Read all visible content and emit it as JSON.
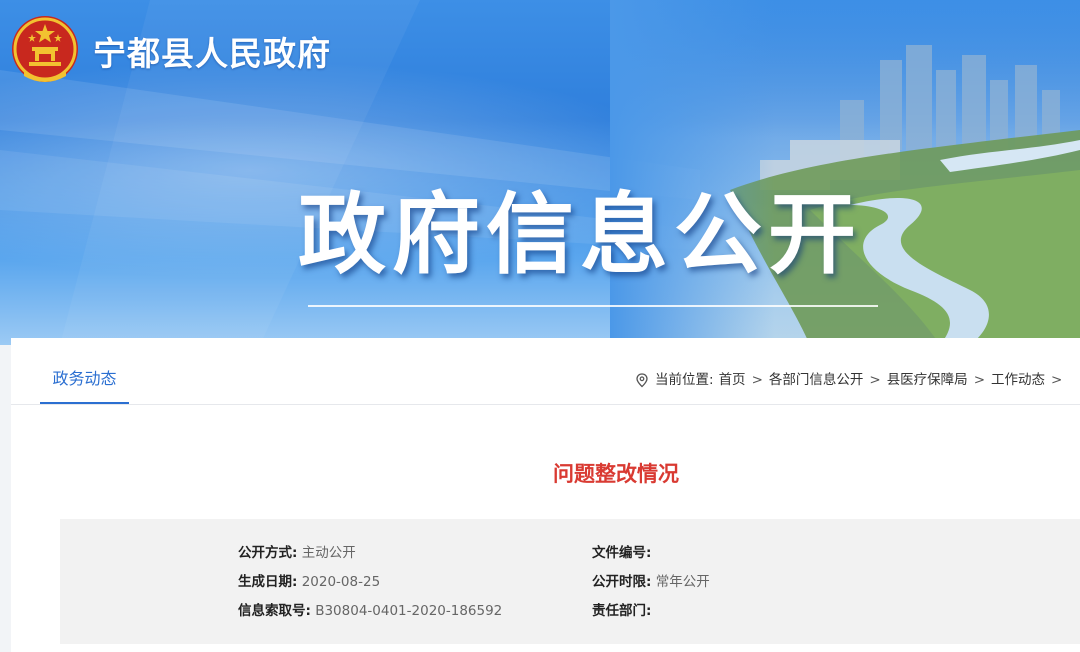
{
  "header": {
    "site_name": "宁都县人民政府",
    "hero_title": "政府信息公开"
  },
  "tabs": {
    "active_label": "政务动态"
  },
  "breadcrumb": {
    "prefix": "当前位置:",
    "items": [
      "首页",
      "各部门信息公开",
      "县医疗保障局",
      "工作动态"
    ],
    "trailing_sep": ">"
  },
  "article": {
    "title": "问题整改情况"
  },
  "meta": {
    "open_method_label": "公开方式:",
    "open_method_value": "主动公开",
    "date_label": "生成日期:",
    "date_value": "2020-08-25",
    "index_label": "信息索取号:",
    "index_value": "B30804-0401-2020-186592",
    "doc_no_label": "文件编号:",
    "doc_no_value": "",
    "period_label": "公开时限:",
    "period_value": "常年公开",
    "dept_label": "责任部门:",
    "dept_value": ""
  },
  "colors": {
    "brand_blue": "#2b6fd1",
    "title_red": "#d93a32",
    "meta_bg": "#f2f2f2"
  },
  "icons": {
    "location": "location-pin-icon",
    "emblem": "national-emblem-icon"
  }
}
